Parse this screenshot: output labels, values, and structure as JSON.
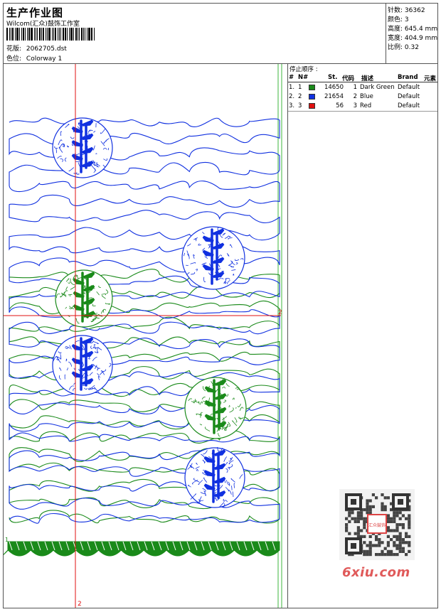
{
  "header": {
    "title": "生产作业图",
    "company": "Wilcom(汇众)鼓饰工作室",
    "design_label": "花版:",
    "design_value": "2062705.dst",
    "colorway_label": "色位:",
    "colorway_value": "Colorway 1"
  },
  "stats": [
    {
      "label": "针数:",
      "value": "36362"
    },
    {
      "label": "颜色:",
      "value": "3"
    },
    {
      "label": "高度:",
      "value": "645.4 mm"
    },
    {
      "label": "宽度:",
      "value": "404.9 mm"
    },
    {
      "label": "比例:",
      "value": "0.32"
    }
  ],
  "stop_sequence": {
    "title": "停止顺序 :",
    "columns": [
      "#",
      "N#",
      "St.",
      "代码",
      "描述",
      "Brand",
      "元素"
    ],
    "rows": [
      {
        "num": "1.",
        "n": "1",
        "color": "#1a8a1a",
        "stitches": "14650",
        "code": "1",
        "desc": "Dark Green",
        "brand": "Default"
      },
      {
        "num": "2.",
        "n": "2",
        "color": "#1030e0",
        "stitches": "21654",
        "code": "2",
        "desc": "Blue",
        "brand": "Default"
      },
      {
        "num": "3.",
        "n": "3",
        "color": "#e01010",
        "stitches": "56",
        "code": "3",
        "desc": "Red",
        "brand": "Default"
      }
    ]
  },
  "design": {
    "markers": {
      "right": "2",
      "bottom": "2",
      "left": "1"
    },
    "colors": {
      "green": "#1a8a1a",
      "blue": "#1030e0",
      "red": "#e01010",
      "guide": "#3cb43c"
    }
  },
  "watermark": {
    "text": "6xiu.com",
    "stamp": "汇众鼓饰"
  }
}
